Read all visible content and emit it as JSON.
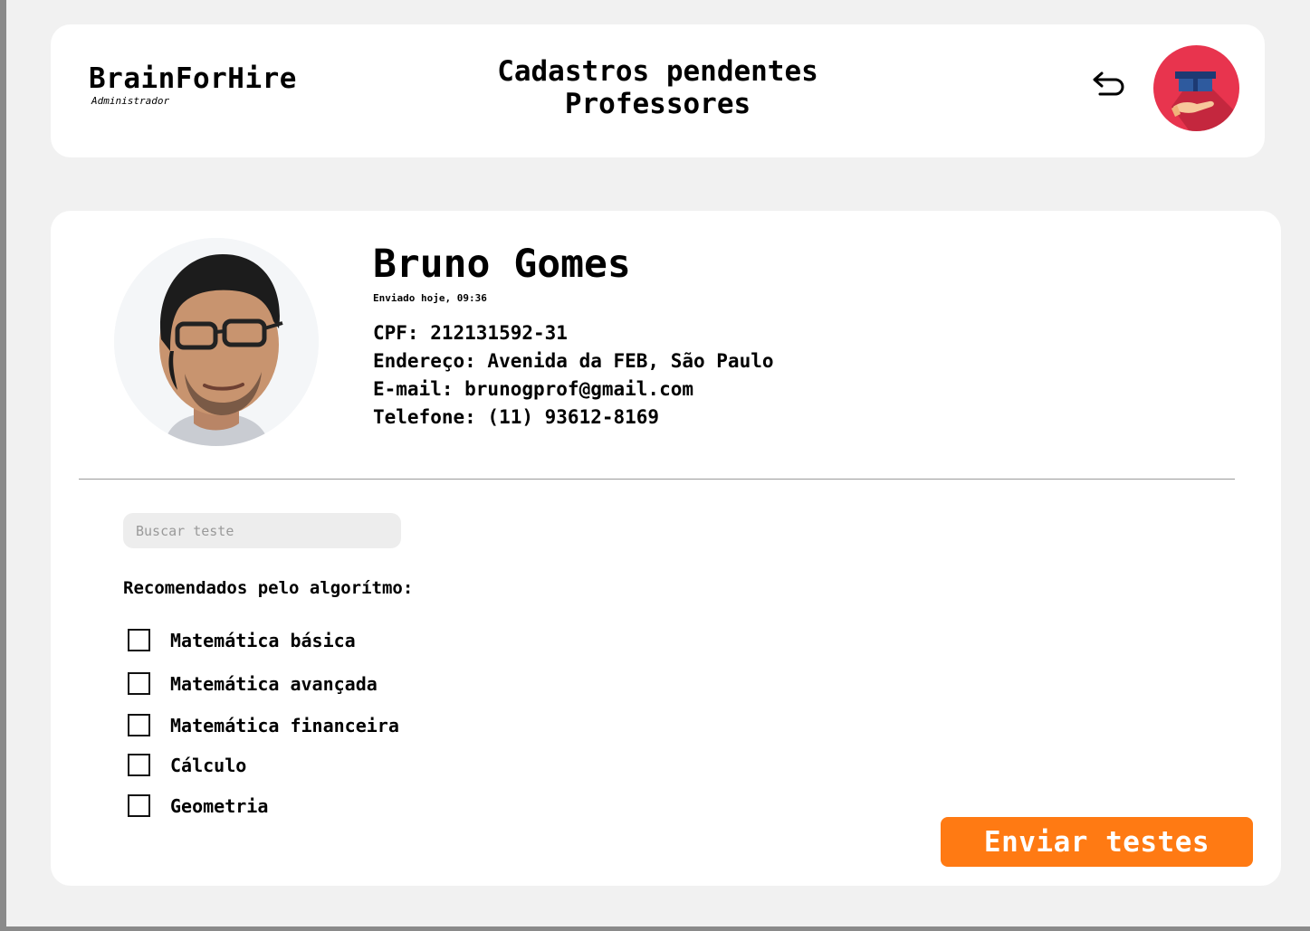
{
  "header": {
    "brand_name": "BrainForHire",
    "brand_role": "Administrador",
    "title_line1": "Cadastros pendentes",
    "title_line2": "Professores",
    "back_icon": "undo-arrow-icon",
    "logo_icon": "graduation-cap-hand-logo"
  },
  "profile": {
    "name": "Bruno Gomes",
    "sent": "Enviado hoje, 09:36",
    "details": [
      "CPF: 212131592-31",
      "Endereço: Avenida da FEB, São Paulo",
      "E-mail: brunogprof@gmail.com",
      "Telefone: (11) 93612-8169"
    ]
  },
  "search": {
    "placeholder": "Buscar teste"
  },
  "recommendations": {
    "title": "Recomendados pelo algorítmo:",
    "tests": [
      "Matemática básica",
      "Matemática avançada",
      "Matemática financeira",
      "Cálculo",
      "Geometria"
    ]
  },
  "actions": {
    "send_label": "Enviar testes"
  },
  "colors": {
    "page_bg": "#f1f1f1",
    "card_bg": "#ffffff",
    "accent": "#ff7a13",
    "logo_bg": "#e8344e"
  }
}
